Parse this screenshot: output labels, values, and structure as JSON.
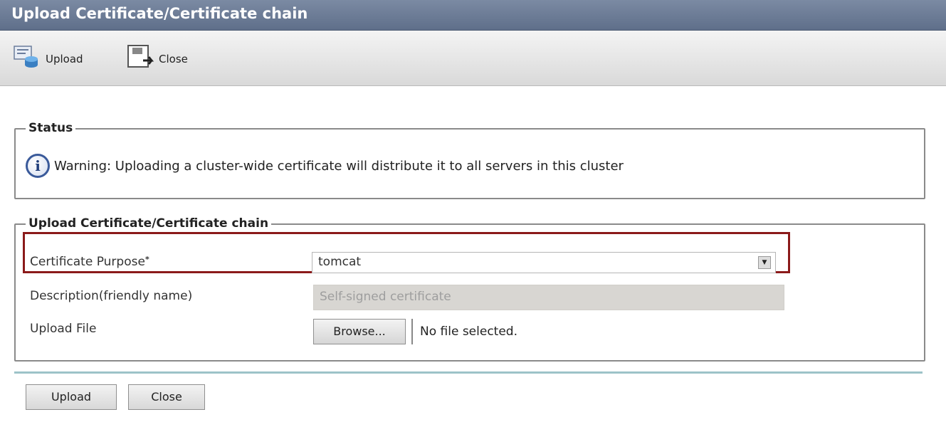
{
  "window": {
    "title": "Upload Certificate/Certificate chain"
  },
  "toolbar": {
    "upload_label": "Upload",
    "upload_icon": "upload-certificate-icon",
    "close_label": "Close",
    "close_icon": "close-window-icon"
  },
  "status": {
    "legend": "Status",
    "icon": "info-icon",
    "message": "Warning: Uploading a cluster-wide certificate will distribute it to all servers in this cluster"
  },
  "upload_form": {
    "legend": "Upload Certificate/Certificate chain",
    "purpose_label": "Certificate Purpose",
    "purpose_required_marker": "*",
    "purpose_value": "tomcat",
    "description_label": "Description(friendly name)",
    "description_value": "Self-signed certificate",
    "file_label": "Upload File",
    "browse_label": "Browse...",
    "file_status": "No file selected."
  },
  "footer": {
    "upload_button": "Upload",
    "close_button": "Close"
  },
  "colors": {
    "title_bar": "#6b7a94",
    "highlight_border": "#8b1a1a",
    "divider": "#9dc3c8"
  }
}
